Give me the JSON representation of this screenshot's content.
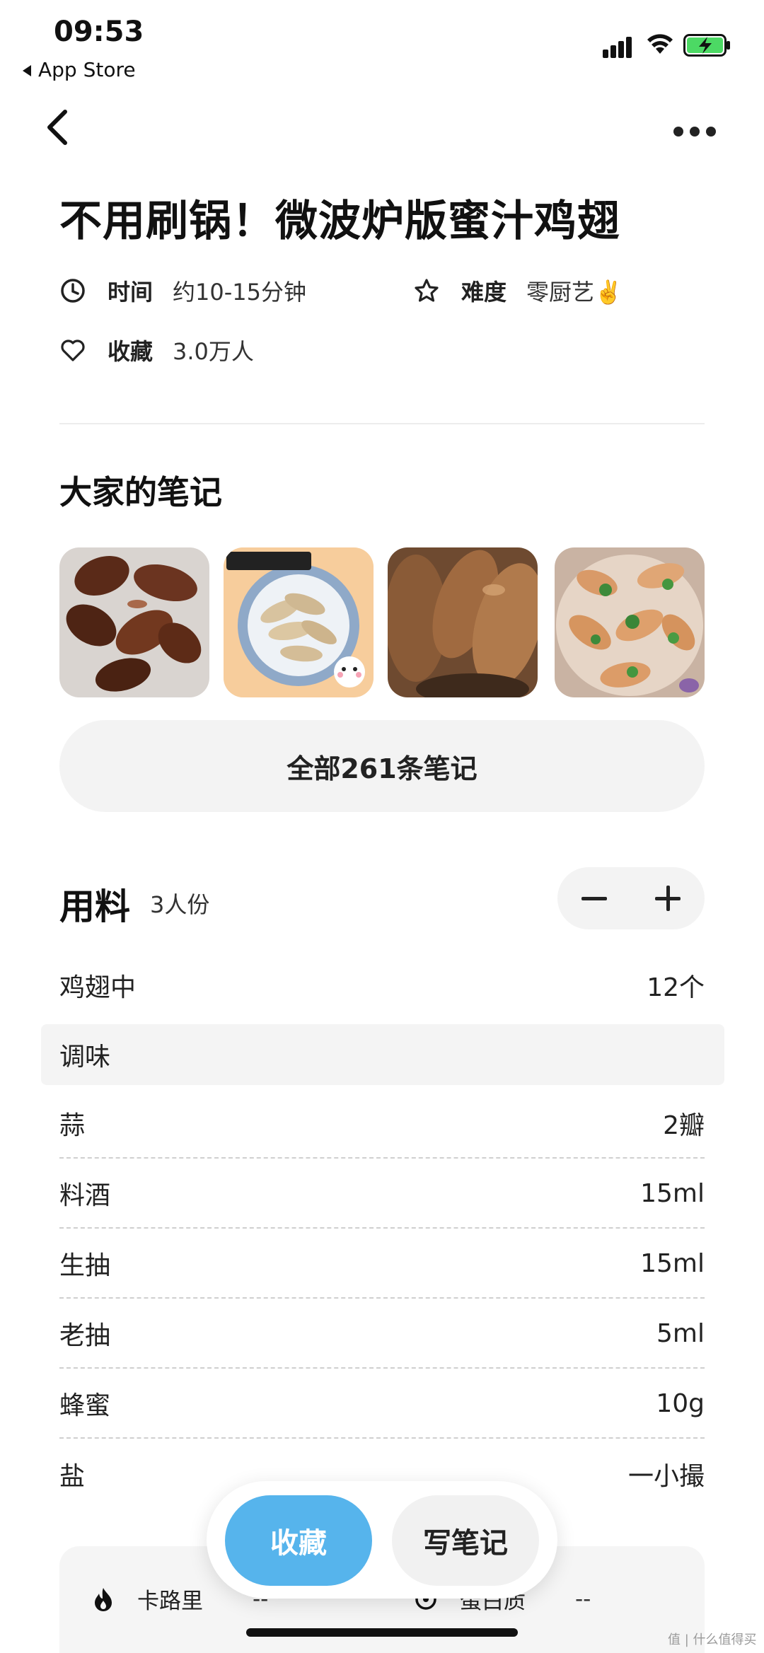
{
  "status_bar": {
    "time": "09:53",
    "back_app": "App Store"
  },
  "recipe": {
    "title": "不用刷锅！微波炉版蜜汁鸡翅",
    "time_label": "时间",
    "time_value": "约10-15分钟",
    "difficulty_label": "难度",
    "difficulty_value": "零厨艺✌️",
    "favorites_label": "收藏",
    "favorites_value": "3.0万人"
  },
  "notes": {
    "section_title": "大家的笔记",
    "thumbnails": [
      {
        "name": "dark-braised-wings-photo"
      },
      {
        "name": "today-food-sticker-photo"
      },
      {
        "name": "glazed-wings-closeup-photo"
      },
      {
        "name": "wings-with-cilantro-photo"
      }
    ],
    "all_notes_button": "全部261条笔记"
  },
  "ingredients": {
    "title": "用料",
    "servings": "3人份",
    "main": [
      {
        "name": "鸡翅中",
        "amount": "12个"
      }
    ],
    "seasoning_header": "调味",
    "seasoning": [
      {
        "name": "蒜",
        "amount": "2瓣"
      },
      {
        "name": "料酒",
        "amount": "15ml"
      },
      {
        "name": "生抽",
        "amount": "15ml"
      },
      {
        "name": "老抽",
        "amount": "5ml"
      },
      {
        "name": "蜂蜜",
        "amount": "10g"
      },
      {
        "name": "盐",
        "amount": "一小撮"
      }
    ]
  },
  "nutrition": {
    "calories_label": "卡路里",
    "calories_value": "--",
    "protein_label": "蛋白质",
    "protein_value": "--"
  },
  "actions": {
    "favorite": "收藏",
    "write_note": "写笔记"
  },
  "watermark": "值 | 什么值得买",
  "colors": {
    "accent": "#56b4ec",
    "battery": "#4cd964"
  }
}
